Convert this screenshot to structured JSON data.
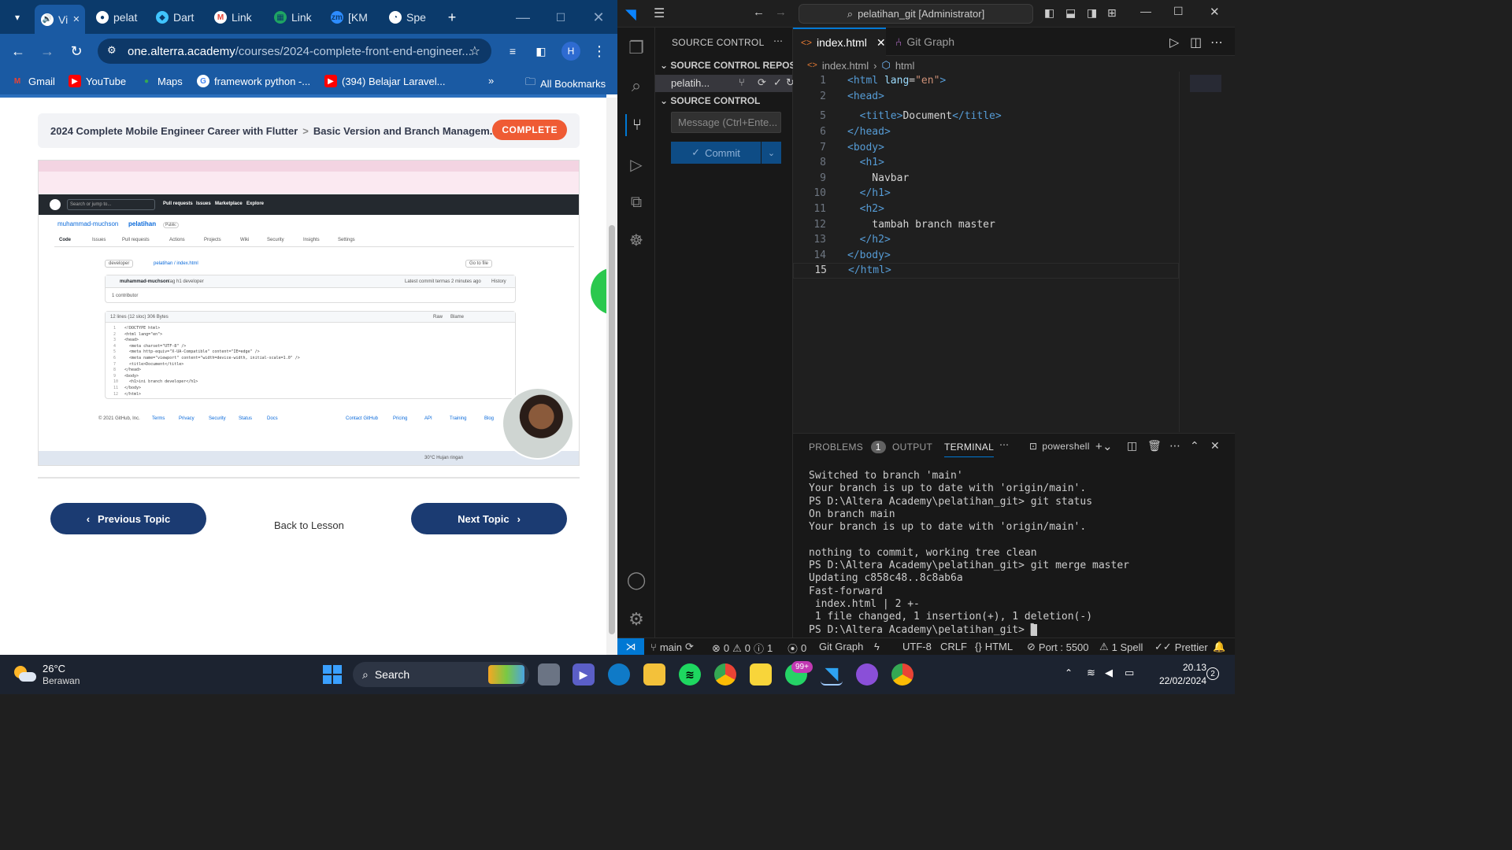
{
  "browser": {
    "tabs": [
      {
        "label": "Vi",
        "favicon": "video-icon",
        "active": true
      },
      {
        "label": "pelat",
        "favicon": "github-icon"
      },
      {
        "label": "Dart",
        "favicon": "dart-icon"
      },
      {
        "label": "Link",
        "favicon": "gmail-icon"
      },
      {
        "label": "Link",
        "favicon": "sheets-icon"
      },
      {
        "label": "[KM",
        "favicon": "zoom-icon"
      },
      {
        "label": "Spe",
        "favicon": "speedtest-icon"
      }
    ],
    "url_host": "one.alterra.academy",
    "url_path": "/courses/2024-complete-front-end-engineer...",
    "profile_initial": "H",
    "bookmarks": [
      "Gmail",
      "YouTube",
      "Maps",
      "framework python -...",
      "(394) Belajar Laravel..."
    ],
    "all_bookmarks": "All Bookmarks"
  },
  "page": {
    "course_title": "2024 Complete Mobile Engineer Career with Flutter",
    "separator": ">",
    "topic_title": "Basic Version and Branch Managem...",
    "complete_label": "COMPLETE",
    "previous_label": "Previous Topic",
    "back_label": "Back to Lesson",
    "next_label": "Next Topic"
  },
  "video": {
    "repo_owner": "muhammad-muchson",
    "repo_name": "pelatihan",
    "visibility": "Public",
    "branch": "developer",
    "file_path": "pelatihan / index.html",
    "go_to_file": "Go to file",
    "commit_author": "muhammad-muchson",
    "commit_msg": "tag h1 developer",
    "commit_meta": "Latest commit termas 2 minutes ago",
    "history": "History",
    "contributor": "1 contributor",
    "file_meta": "12 lines (12 sloc)   306 Bytes",
    "raw": "Raw",
    "blame": "Blame",
    "code_lines": [
      "<!DOCTYPE html>",
      "<html lang=\"en\">",
      "<head>",
      "  <meta charset=\"UTF-8\" />",
      "  <meta http-equiv=\"X-UA-Compatible\" content=\"IE=edge\" />",
      "  <meta name=\"viewport\" content=\"width=device-width, initial-scale=1.0\" />",
      "  <title>Document</title>",
      "</head>",
      "<body>",
      "  <h1>ini branch developer</h1>",
      "</body>",
      "</html>"
    ],
    "footer": [
      "© 2021 GitHub, Inc.",
      "Terms",
      "Privacy",
      "Security",
      "Status",
      "Docs",
      "Contact GitHub",
      "Pricing",
      "API",
      "Training",
      "Blog"
    ],
    "gh_nav": [
      "Pull requests",
      "Issues",
      "Marketplace",
      "Explore"
    ],
    "gh_search": "Search or jump to...",
    "gh_tabs": [
      "Code",
      "Issues",
      "Pull requests",
      "Actions",
      "Projects",
      "Wiki",
      "Security",
      "Insights",
      "Settings"
    ],
    "weather": "30°C  Hujan ringan"
  },
  "vscode": {
    "search": "pelatihan_git [Administrator]",
    "sidebar_header": "SOURCE CONTROL",
    "repos_header": "SOURCE CONTROL REPOSI...",
    "repo_name": "pelatih...",
    "sc_header": "SOURCE CONTROL",
    "message_placeholder": "Message (Ctrl+Ente...",
    "commit_label": "Commit",
    "tabs": [
      {
        "label": "index.html",
        "active": true
      },
      {
        "label": "Git Graph"
      }
    ],
    "breadcrumb": [
      "index.html",
      "html"
    ],
    "code": [
      {
        "n": "1",
        "html": "<span class='tag'>&lt;html</span> <span class='attr'>lang</span>=<span class='str'>\"en\"</span><span class='tag'>&gt;</span>"
      },
      {
        "n": "2",
        "html": "<span class='tag'>&lt;head&gt;</span>"
      },
      {
        "n": "5",
        "html": "  <span class='tag'>&lt;title&gt;</span>Document<span class='tag'>&lt;/title&gt;</span>"
      },
      {
        "n": "6",
        "html": "<span class='tag'>&lt;/head&gt;</span>"
      },
      {
        "n": "7",
        "html": "<span class='tag'>&lt;body&gt;</span>"
      },
      {
        "n": "8",
        "html": "  <span class='tag'>&lt;h1&gt;</span>"
      },
      {
        "n": "9",
        "html": "    Navbar"
      },
      {
        "n": "10",
        "html": "  <span class='tag'>&lt;/h1&gt;</span>"
      },
      {
        "n": "11",
        "html": "  <span class='tag'>&lt;h2&gt;</span>"
      },
      {
        "n": "12",
        "html": "    tambah branch master"
      },
      {
        "n": "13",
        "html": "  <span class='tag'>&lt;/h2&gt;</span>"
      },
      {
        "n": "14",
        "html": "<span class='tag'>&lt;/body&gt;</span>"
      },
      {
        "n": "15",
        "html": "<span class='tag'>&lt;/html&gt;</span>"
      }
    ],
    "panel_tabs": [
      "PROBLEMS",
      "OUTPUT",
      "TERMINAL"
    ],
    "problems_count": "1",
    "shell": "powershell",
    "terminal": "Switched to branch 'main'\nYour branch is up to date with 'origin/main'.\nPS D:\\Altera Academy\\pelatihan_git> git status\nOn branch main\nYour branch is up to date with 'origin/main'.\n\nnothing to commit, working tree clean\nPS D:\\Altera Academy\\pelatihan_git> git merge master\nUpdating c858c48..8c8ab6a\nFast-forward\n index.html | 2 +-\n 1 file changed, 1 insertion(+), 1 deletion(-)\nPS D:\\Altera Academy\\pelatihan_git> ",
    "status": {
      "branch": "main",
      "errors": "0",
      "warnings": "0",
      "info": "1",
      "ports": "0",
      "git_graph": "Git Graph",
      "encoding": "UTF-8",
      "eol": "CRLF",
      "language": "HTML",
      "port": "Port : 5500",
      "spell": "1 Spell",
      "prettier": "Prettier"
    }
  },
  "taskbar": {
    "temp": "26°C",
    "weather": "Berawan",
    "search": "Search",
    "badge": "99+",
    "time": "20.13",
    "date": "22/02/2024",
    "notif": "2"
  }
}
